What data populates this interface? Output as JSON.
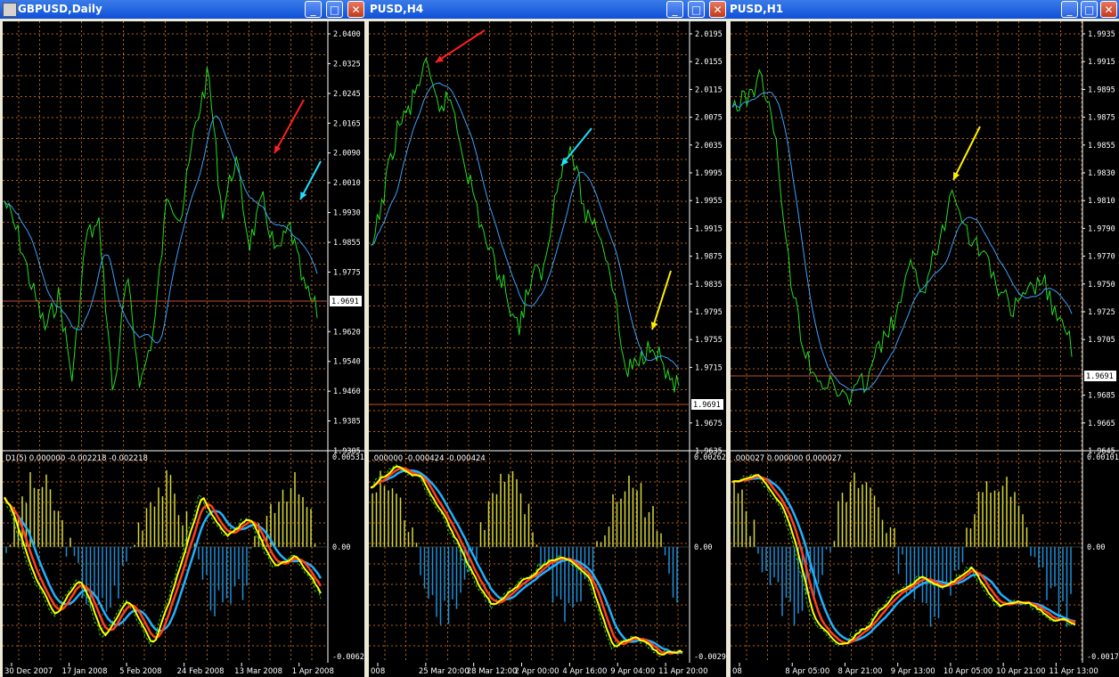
{
  "windows": [
    {
      "id": "w1",
      "title": "GBPUSD,Daily",
      "price_labels": [
        "2.0400",
        "2.0325",
        "2.0245",
        "2.0165",
        "2.0090",
        "2.0010",
        "1.9930",
        "1.9855",
        "1.9775",
        "1.9691",
        "1.9620",
        "1.9540",
        "1.9460",
        "1.9385",
        "1.9305"
      ],
      "current_price": "1.9691",
      "indicator_header": "D1(5) 0.000000 -0.002218 -0.002218",
      "indicator_labels": [
        "0.005318",
        "0.00",
        "-0.00627"
      ],
      "time_labels": [
        "30 Dec 2007",
        "17 Jan 2008",
        "5 Feb 2008",
        "24 Feb 2008",
        "13 Mar 2008",
        "1 Apr 2008"
      ]
    },
    {
      "id": "w2",
      "title": "PUSD,H4",
      "price_labels": [
        "2.0195",
        "2.0155",
        "2.0115",
        "2.0075",
        "2.0035",
        "1.9995",
        "1.9955",
        "1.9915",
        "1.9875",
        "1.9835",
        "1.9795",
        "1.9755",
        "1.9715",
        "1.9691",
        "1.9675",
        "1.9635"
      ],
      "current_price": "1.9691",
      "indicator_header": ".000000 -0.000424 -0.000424",
      "indicator_labels": [
        "0.002629",
        "0.00",
        "-0.00298"
      ],
      "time_labels": [
        "008",
        "25 Mar 20:00",
        "28 Mar 12:00",
        "2 Apr 00:00",
        "4 Apr 16:00",
        "9 Apr 04:00",
        "11 Apr 20:00"
      ]
    },
    {
      "id": "w3",
      "title": "PUSD,H1",
      "price_labels": [
        "1.9935",
        "1.9915",
        "1.9895",
        "1.9875",
        "1.9855",
        "1.9830",
        "1.9810",
        "1.9790",
        "1.9770",
        "1.9750",
        "1.9725",
        "1.9705",
        "1.9691",
        "1.9685",
        "1.9665",
        "1.9645"
      ],
      "current_price": "1.9691",
      "indicator_header": ".000027 0.000000 0.000027",
      "indicator_labels": [
        "0.001014",
        "0.00",
        "-0.0017"
      ],
      "time_labels": [
        "08",
        "8 Apr 05:00",
        "8 Apr 21:00",
        "9 Apr 13:00",
        "10 Apr 05:00",
        "10 Apr 21:00",
        "11 Apr 13:00"
      ]
    }
  ],
  "title_buttons": {
    "minimize": "_",
    "maximize": "□",
    "close": "✕"
  },
  "colors": {
    "background": "#000000",
    "grid": "#b5651d",
    "price_line": "#22dd22",
    "moving_average": "#3aa0ff",
    "histogram_positive": "#d6d63a",
    "histogram_negative": "#1e8fd8",
    "fast_line": "#ffff00",
    "mid_line": "#ff4020",
    "slow_line": "#22b0ff",
    "arrow_red": "#ff2020",
    "arrow_cyan": "#20e0ff",
    "arrow_yellow": "#ffee00"
  }
}
